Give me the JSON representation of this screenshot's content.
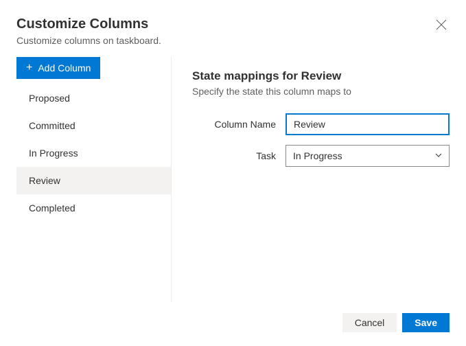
{
  "header": {
    "title": "Customize Columns",
    "subtitle": "Customize columns on taskboard."
  },
  "sidebar": {
    "add_button_label": "Add Column",
    "items": [
      {
        "label": "Proposed",
        "selected": false
      },
      {
        "label": "Committed",
        "selected": false
      },
      {
        "label": "In Progress",
        "selected": false
      },
      {
        "label": "Review",
        "selected": true
      },
      {
        "label": "Completed",
        "selected": false
      }
    ]
  },
  "main": {
    "section_title": "State mappings for Review",
    "section_desc": "Specify the state this column maps to",
    "fields": {
      "column_name_label": "Column Name",
      "column_name_value": "Review",
      "task_label": "Task",
      "task_value": "In Progress"
    }
  },
  "footer": {
    "cancel_label": "Cancel",
    "save_label": "Save"
  }
}
